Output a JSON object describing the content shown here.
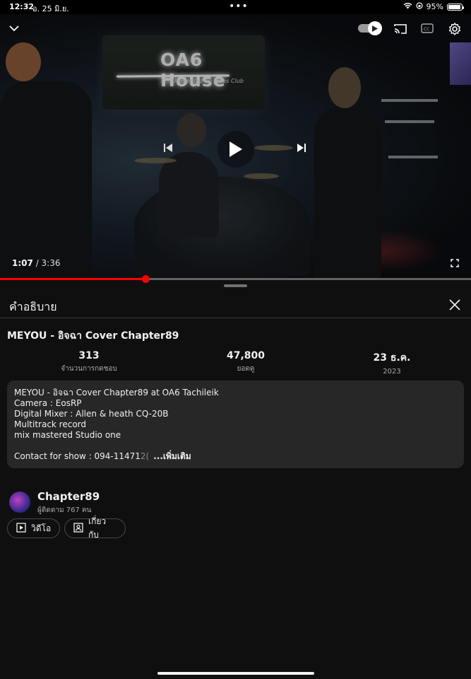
{
  "status_bar": {
    "time": "12:32",
    "date": "อ. 25 มิ.ย.",
    "battery": "95%",
    "battery_level": 0.95
  },
  "player": {
    "current_time": "1:07",
    "duration": "3:36",
    "progress_fraction": 0.309,
    "sign_text": "OA6 House",
    "sign_subtext": "Presented By Vibes Club"
  },
  "panel": {
    "title": "คำอธิบาย"
  },
  "video": {
    "title": "MEYOU - อิจฉา Cover Chapter89",
    "likes": "313",
    "likes_label": "จำนวนการกดชอบ",
    "views": "47,800",
    "views_label": "ยอดดู",
    "date": "23 ธ.ค.",
    "year": "2023"
  },
  "description": {
    "lines": [
      "MEYOU - อิจฉา Cover Chapter89 at OA6 Tachileik",
      "Camera : EosRP",
      "Digital Mixer : Allen & heath CQ-20B",
      "Multitrack record",
      "mix mastered Studio one"
    ],
    "contact_prefix": "Contact for show : 094-11471",
    "contact_faded": "2(",
    "more_label": "...เพิ่มเติม"
  },
  "channel": {
    "name": "Chapter89",
    "subscribers": "ผู้ติดตาม 767 คน",
    "videos_button": "วิดีโอ",
    "about_button": "เกี่ยวกับ"
  }
}
